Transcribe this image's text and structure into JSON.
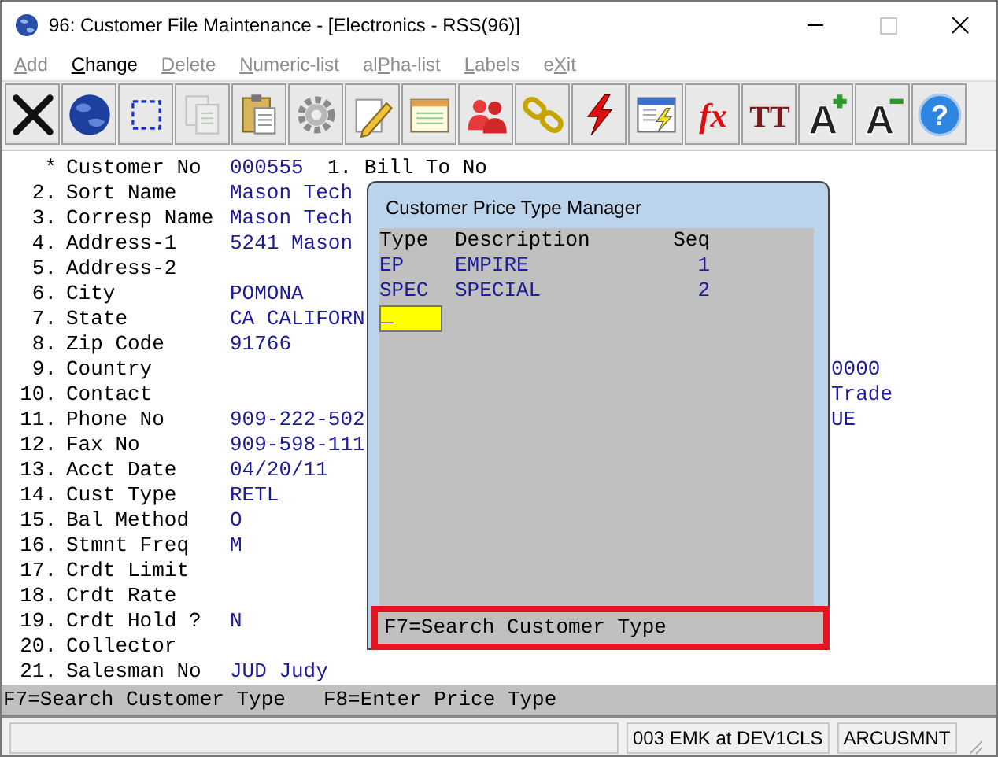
{
  "window": {
    "title": "96: Customer File Maintenance - [Electronics - RSS(96)]",
    "maximize_disabled": true
  },
  "menu": [
    {
      "key": "A",
      "post": "dd",
      "disabled": true
    },
    {
      "key": "C",
      "post": "hange",
      "disabled": false
    },
    {
      "key": "D",
      "post": "elete",
      "disabled": true
    },
    {
      "key": "N",
      "post": "umeric-list",
      "disabled": true
    },
    {
      "pre": "al",
      "key": "P",
      "post": "ha-list",
      "disabled": true
    },
    {
      "key": "L",
      "post": "abels",
      "disabled": true
    },
    {
      "pre": "e",
      "key": "X",
      "post": "it",
      "disabled": true
    }
  ],
  "toolbar": [
    {
      "kind": "close",
      "disabled": false
    },
    {
      "kind": "globe",
      "disabled": false
    },
    {
      "kind": "select",
      "disabled": false
    },
    {
      "kind": "copy",
      "disabled": true
    },
    {
      "kind": "paste",
      "disabled": false
    },
    {
      "kind": "gear",
      "disabled": false
    },
    {
      "kind": "pencil",
      "disabled": false
    },
    {
      "kind": "notepad",
      "disabled": false
    },
    {
      "kind": "people",
      "disabled": false
    },
    {
      "kind": "chain",
      "disabled": false
    },
    {
      "kind": "lightning",
      "disabled": false
    },
    {
      "kind": "window-lightning",
      "disabled": false
    },
    {
      "kind": "fx",
      "glyph": "fx",
      "disabled": false
    },
    {
      "kind": "font",
      "glyph": "TT",
      "disabled": false
    },
    {
      "kind": "font-plus",
      "glyph": "A",
      "disabled": false
    },
    {
      "kind": "font-minus",
      "glyph": "A",
      "disabled": false
    },
    {
      "kind": "help",
      "glyph": "?",
      "disabled": false
    }
  ],
  "form": [
    {
      "num": "*",
      "label": "Customer No",
      "value": "000555",
      "side": {
        "kind": "near",
        "text": "1. Bill To No"
      }
    },
    {
      "num": "2.",
      "label": "Sort Name",
      "value": "Mason Tech"
    },
    {
      "num": "3.",
      "label": "Corresp Name",
      "value": "Mason Tech"
    },
    {
      "num": "4.",
      "label": "Address-1",
      "value": "5241 Mason"
    },
    {
      "num": "5.",
      "label": "Address-2"
    },
    {
      "num": "6.",
      "label": "City",
      "value": "POMONA"
    },
    {
      "num": "7.",
      "label": "State",
      "value": "CA CALIFORN"
    },
    {
      "num": "8.",
      "label": "Zip Code",
      "value": "91766"
    },
    {
      "num": "9.",
      "label": "Country",
      "side": {
        "kind": "far",
        "text": "0000"
      }
    },
    {
      "num": "10.",
      "label": "Contact",
      "side": {
        "kind": "far",
        "text": " Trade"
      }
    },
    {
      "num": "11.",
      "label": "Phone No",
      "value": "909-222-502",
      "side": {
        "kind": "far",
        "text": "UE"
      }
    },
    {
      "num": "12.",
      "label": "Fax No",
      "value": "909-598-111"
    },
    {
      "num": "13.",
      "label": "Acct Date",
      "value": "04/20/11"
    },
    {
      "num": "14.",
      "label": "Cust Type",
      "value": "RETL"
    },
    {
      "num": "15.",
      "label": "Bal Method",
      "value": "O"
    },
    {
      "num": "16.",
      "label": "Stmnt Freq",
      "value": "M"
    },
    {
      "num": "17.",
      "label": "Crdt Limit"
    },
    {
      "num": "18.",
      "label": "Crdt Rate"
    },
    {
      "num": "19.",
      "label": "Crdt Hold ?",
      "value": "N"
    },
    {
      "num": "20.",
      "label": "Collector"
    },
    {
      "num": "21.",
      "label": "Salesman No",
      "value": "JUD Judy"
    }
  ],
  "function_keys": [
    "F7=Search Customer Type",
    "F8=Enter Price Type"
  ],
  "dialog": {
    "title": "Customer Price Type Manager",
    "columns": [
      "Type",
      "Description",
      "Seq"
    ],
    "rows": [
      [
        "EP",
        "EMPIRE",
        "1"
      ],
      [
        "SPEC",
        "SPECIAL",
        "2"
      ]
    ],
    "input": {
      "value": "_"
    },
    "hint": "F7=Search Customer Type",
    "hint_highlighted": true
  },
  "status_bar": {
    "user": "003 EMK at DEV1CLS",
    "program": "ARCUSMNT"
  }
}
